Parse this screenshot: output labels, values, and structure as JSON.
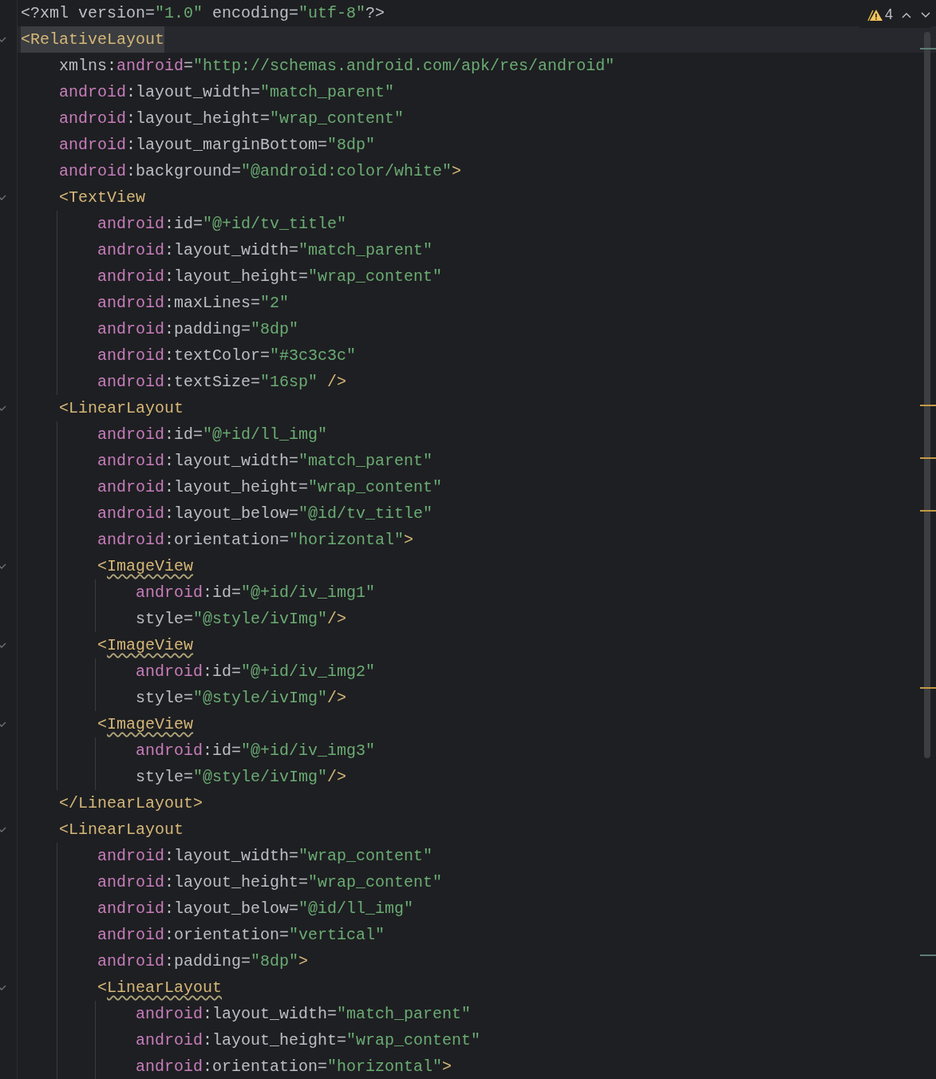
{
  "inspections": {
    "count": "4"
  },
  "lines": [
    {
      "fold": false,
      "current": false,
      "tokens": [
        {
          "kind": "plain",
          "text": "<?xml version="
        },
        {
          "kind": "value",
          "text": "\"1.0\""
        },
        {
          "kind": "plain",
          "text": " encoding="
        },
        {
          "kind": "value",
          "text": "\"utf-8\""
        },
        {
          "kind": "plain",
          "text": "?>"
        }
      ]
    },
    {
      "fold": true,
      "current": true,
      "tokens": [
        {
          "kind": "tag-match",
          "text": "<RelativeLayout"
        }
      ],
      "children": [
        {
          "fold": false,
          "current": false,
          "tokens": [
            {
              "kind": "plain",
              "text": "xmlns:"
            },
            {
              "kind": "ns",
              "text": "android"
            },
            {
              "kind": "plain",
              "text": "="
            },
            {
              "kind": "value",
              "text": "\"http://schemas.android.com/apk/res/android\""
            }
          ]
        },
        {
          "fold": false,
          "current": false,
          "tokens": [
            {
              "kind": "ns",
              "text": "android"
            },
            {
              "kind": "plain",
              "text": ":layout_width="
            },
            {
              "kind": "value",
              "text": "\"match_parent\""
            }
          ]
        },
        {
          "fold": false,
          "current": false,
          "tokens": [
            {
              "kind": "ns",
              "text": "android"
            },
            {
              "kind": "plain",
              "text": ":layout_height="
            },
            {
              "kind": "value",
              "text": "\"wrap_content\""
            }
          ]
        },
        {
          "fold": false,
          "current": false,
          "tokens": [
            {
              "kind": "ns",
              "text": "android"
            },
            {
              "kind": "plain",
              "text": ":layout_marginBottom="
            },
            {
              "kind": "value",
              "text": "\"8dp\""
            }
          ]
        },
        {
          "fold": false,
          "current": false,
          "tokens": [
            {
              "kind": "ns",
              "text": "android"
            },
            {
              "kind": "plain",
              "text": ":background="
            },
            {
              "kind": "value",
              "text": "\"@android:color/white\""
            },
            {
              "kind": "tag",
              "text": ">"
            }
          ]
        },
        {
          "fold": true,
          "current": false,
          "tokens": [
            {
              "kind": "tag",
              "text": "<TextView"
            }
          ],
          "children": [
            {
              "fold": false,
              "current": false,
              "tokens": [
                {
                  "kind": "ns",
                  "text": "android"
                },
                {
                  "kind": "plain",
                  "text": ":id="
                },
                {
                  "kind": "value",
                  "text": "\"@+id/tv_title\""
                }
              ]
            },
            {
              "fold": false,
              "current": false,
              "tokens": [
                {
                  "kind": "ns",
                  "text": "android"
                },
                {
                  "kind": "plain",
                  "text": ":layout_width="
                },
                {
                  "kind": "value",
                  "text": "\"match_parent\""
                }
              ]
            },
            {
              "fold": false,
              "current": false,
              "tokens": [
                {
                  "kind": "ns",
                  "text": "android"
                },
                {
                  "kind": "plain",
                  "text": ":layout_height="
                },
                {
                  "kind": "value",
                  "text": "\"wrap_content\""
                }
              ]
            },
            {
              "fold": false,
              "current": false,
              "tokens": [
                {
                  "kind": "ns",
                  "text": "android"
                },
                {
                  "kind": "plain",
                  "text": ":maxLines="
                },
                {
                  "kind": "value",
                  "text": "\"2\""
                }
              ]
            },
            {
              "fold": false,
              "current": false,
              "tokens": [
                {
                  "kind": "ns",
                  "text": "android"
                },
                {
                  "kind": "plain",
                  "text": ":padding="
                },
                {
                  "kind": "value",
                  "text": "\"8dp\""
                }
              ]
            },
            {
              "fold": false,
              "current": false,
              "tokens": [
                {
                  "kind": "ns",
                  "text": "android"
                },
                {
                  "kind": "plain",
                  "text": ":textColor="
                },
                {
                  "kind": "value",
                  "text": "\"#3c3c3c\""
                }
              ]
            },
            {
              "fold": false,
              "current": false,
              "tokens": [
                {
                  "kind": "ns",
                  "text": "android"
                },
                {
                  "kind": "plain",
                  "text": ":textSize="
                },
                {
                  "kind": "value",
                  "text": "\"16sp\""
                },
                {
                  "kind": "tag",
                  "text": " />"
                }
              ]
            }
          ]
        },
        {
          "fold": true,
          "current": false,
          "tokens": [
            {
              "kind": "tag",
              "text": "<LinearLayout"
            }
          ],
          "children": [
            {
              "fold": false,
              "current": false,
              "tokens": [
                {
                  "kind": "ns",
                  "text": "android"
                },
                {
                  "kind": "plain",
                  "text": ":id="
                },
                {
                  "kind": "value",
                  "text": "\"@+id/ll_img\""
                }
              ]
            },
            {
              "fold": false,
              "current": false,
              "tokens": [
                {
                  "kind": "ns",
                  "text": "android"
                },
                {
                  "kind": "plain",
                  "text": ":layout_width="
                },
                {
                  "kind": "value",
                  "text": "\"match_parent\""
                }
              ]
            },
            {
              "fold": false,
              "current": false,
              "tokens": [
                {
                  "kind": "ns",
                  "text": "android"
                },
                {
                  "kind": "plain",
                  "text": ":layout_height="
                },
                {
                  "kind": "value",
                  "text": "\"wrap_content\""
                }
              ]
            },
            {
              "fold": false,
              "current": false,
              "tokens": [
                {
                  "kind": "ns",
                  "text": "android"
                },
                {
                  "kind": "plain",
                  "text": ":layout_below="
                },
                {
                  "kind": "value",
                  "text": "\"@id/tv_title\""
                }
              ]
            },
            {
              "fold": false,
              "current": false,
              "tokens": [
                {
                  "kind": "ns",
                  "text": "android"
                },
                {
                  "kind": "plain",
                  "text": ":orientation="
                },
                {
                  "kind": "value",
                  "text": "\"horizontal\""
                },
                {
                  "kind": "tag",
                  "text": ">"
                }
              ]
            },
            {
              "fold": true,
              "current": false,
              "tokens": [
                {
                  "kind": "tag",
                  "text": "<"
                },
                {
                  "kind": "tag-warn",
                  "text": "ImageView"
                }
              ],
              "children": [
                {
                  "fold": false,
                  "current": false,
                  "tokens": [
                    {
                      "kind": "ns",
                      "text": "android"
                    },
                    {
                      "kind": "plain",
                      "text": ":id="
                    },
                    {
                      "kind": "value",
                      "text": "\"@+id/iv_img1\""
                    }
                  ]
                },
                {
                  "fold": false,
                  "current": false,
                  "tokens": [
                    {
                      "kind": "plain",
                      "text": "style="
                    },
                    {
                      "kind": "value",
                      "text": "\"@style/ivImg\""
                    },
                    {
                      "kind": "tag",
                      "text": "/>"
                    }
                  ]
                }
              ]
            },
            {
              "fold": true,
              "current": false,
              "tokens": [
                {
                  "kind": "tag",
                  "text": "<"
                },
                {
                  "kind": "tag-warn",
                  "text": "ImageView"
                }
              ],
              "children": [
                {
                  "fold": false,
                  "current": false,
                  "tokens": [
                    {
                      "kind": "ns",
                      "text": "android"
                    },
                    {
                      "kind": "plain",
                      "text": ":id="
                    },
                    {
                      "kind": "value",
                      "text": "\"@+id/iv_img2\""
                    }
                  ]
                },
                {
                  "fold": false,
                  "current": false,
                  "tokens": [
                    {
                      "kind": "plain",
                      "text": "style="
                    },
                    {
                      "kind": "value",
                      "text": "\"@style/ivImg\""
                    },
                    {
                      "kind": "tag",
                      "text": "/>"
                    }
                  ]
                }
              ]
            },
            {
              "fold": true,
              "current": false,
              "tokens": [
                {
                  "kind": "tag",
                  "text": "<"
                },
                {
                  "kind": "tag-warn",
                  "text": "ImageView"
                }
              ],
              "children": [
                {
                  "fold": false,
                  "current": false,
                  "tokens": [
                    {
                      "kind": "ns",
                      "text": "android"
                    },
                    {
                      "kind": "plain",
                      "text": ":id="
                    },
                    {
                      "kind": "value",
                      "text": "\"@+id/iv_img3\""
                    }
                  ]
                },
                {
                  "fold": false,
                  "current": false,
                  "tokens": [
                    {
                      "kind": "plain",
                      "text": "style="
                    },
                    {
                      "kind": "value",
                      "text": "\"@style/ivImg\""
                    },
                    {
                      "kind": "tag",
                      "text": "/>"
                    }
                  ]
                }
              ]
            }
          ]
        },
        {
          "fold": false,
          "current": false,
          "tokens": [
            {
              "kind": "tag",
              "text": "</LinearLayout>"
            }
          ]
        },
        {
          "fold": true,
          "current": false,
          "tokens": [
            {
              "kind": "tag",
              "text": "<LinearLayout"
            }
          ],
          "children": [
            {
              "fold": false,
              "current": false,
              "tokens": [
                {
                  "kind": "ns",
                  "text": "android"
                },
                {
                  "kind": "plain",
                  "text": ":layout_width="
                },
                {
                  "kind": "value",
                  "text": "\"wrap_content\""
                }
              ]
            },
            {
              "fold": false,
              "current": false,
              "tokens": [
                {
                  "kind": "ns",
                  "text": "android"
                },
                {
                  "kind": "plain",
                  "text": ":layout_height="
                },
                {
                  "kind": "value",
                  "text": "\"wrap_content\""
                }
              ]
            },
            {
              "fold": false,
              "current": false,
              "tokens": [
                {
                  "kind": "ns",
                  "text": "android"
                },
                {
                  "kind": "plain",
                  "text": ":layout_below="
                },
                {
                  "kind": "value",
                  "text": "\"@id/ll_img\""
                }
              ]
            },
            {
              "fold": false,
              "current": false,
              "tokens": [
                {
                  "kind": "ns",
                  "text": "android"
                },
                {
                  "kind": "plain",
                  "text": ":orientation="
                },
                {
                  "kind": "value",
                  "text": "\"vertical\""
                }
              ]
            },
            {
              "fold": false,
              "current": false,
              "tokens": [
                {
                  "kind": "ns",
                  "text": "android"
                },
                {
                  "kind": "plain",
                  "text": ":padding="
                },
                {
                  "kind": "value",
                  "text": "\"8dp\""
                },
                {
                  "kind": "tag",
                  "text": ">"
                }
              ]
            },
            {
              "fold": true,
              "current": false,
              "tokens": [
                {
                  "kind": "tag",
                  "text": "<"
                },
                {
                  "kind": "tag-warn",
                  "text": "LinearLayout"
                }
              ],
              "children": [
                {
                  "fold": false,
                  "current": false,
                  "tokens": [
                    {
                      "kind": "ns",
                      "text": "android"
                    },
                    {
                      "kind": "plain",
                      "text": ":layout_width="
                    },
                    {
                      "kind": "value",
                      "text": "\"match_parent\""
                    }
                  ]
                },
                {
                  "fold": false,
                  "current": false,
                  "tokens": [
                    {
                      "kind": "ns",
                      "text": "android"
                    },
                    {
                      "kind": "plain",
                      "text": ":layout_height="
                    },
                    {
                      "kind": "value",
                      "text": "\"wrap_content\""
                    }
                  ]
                },
                {
                  "fold": false,
                  "current": false,
                  "tokens": [
                    {
                      "kind": "ns",
                      "text": "android"
                    },
                    {
                      "kind": "plain",
                      "text": ":orientation="
                    },
                    {
                      "kind": "value",
                      "text": "\"horizontal\""
                    },
                    {
                      "kind": "tag",
                      "text": ">"
                    }
                  ]
                }
              ]
            }
          ]
        }
      ]
    }
  ]
}
